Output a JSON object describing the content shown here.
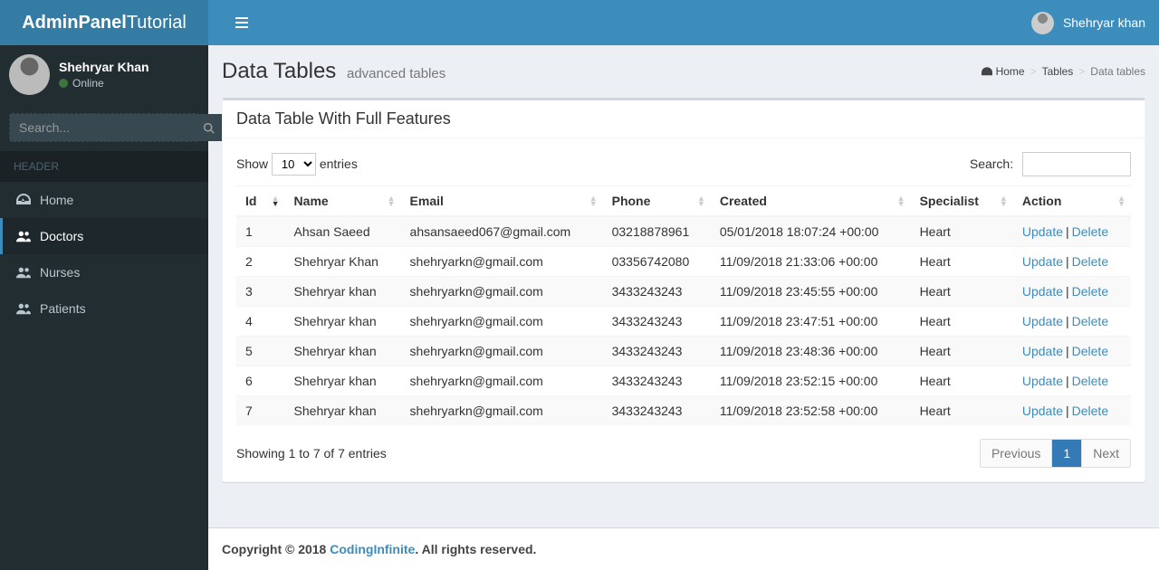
{
  "brand": {
    "bold": "AdminPanel",
    "light": "Tutorial"
  },
  "header_user": {
    "name": "Shehryar khan"
  },
  "sidebar": {
    "user": {
      "name": "Shehryar Khan",
      "status": "Online"
    },
    "search_placeholder": "Search...",
    "header": "HEADER",
    "items": [
      {
        "label": "Home",
        "icon": "dashboard",
        "active": false
      },
      {
        "label": "Doctors",
        "icon": "users",
        "active": true
      },
      {
        "label": "Nurses",
        "icon": "users",
        "active": false
      },
      {
        "label": "Patients",
        "icon": "users",
        "active": false
      }
    ]
  },
  "page": {
    "title": "Data Tables",
    "subtitle": "advanced tables",
    "breadcrumb": [
      {
        "label": "Home",
        "icon": true,
        "active": false
      },
      {
        "label": "Tables",
        "icon": false,
        "active": false
      },
      {
        "label": "Data tables",
        "icon": false,
        "active": true
      }
    ]
  },
  "box": {
    "title": "Data Table With Full Features",
    "length": {
      "prefix": "Show",
      "suffix": "entries",
      "value": "10"
    },
    "search_label": "Search:",
    "columns": [
      "Id",
      "Name",
      "Email",
      "Phone",
      "Created",
      "Specialist",
      "Action"
    ],
    "rows": [
      {
        "id": "1",
        "name": "Ahsan Saeed",
        "email": "ahsansaeed067@gmail.com",
        "phone": "03218878961",
        "created": "05/01/2018 18:07:24 +00:00",
        "specialist": "Heart"
      },
      {
        "id": "2",
        "name": "Shehryar Khan",
        "email": "shehryarkn@gmail.com",
        "phone": "03356742080",
        "created": "11/09/2018 21:33:06 +00:00",
        "specialist": "Heart"
      },
      {
        "id": "3",
        "name": "Shehryar khan",
        "email": "shehryarkn@gmail.com",
        "phone": "3433243243",
        "created": "11/09/2018 23:45:55 +00:00",
        "specialist": "Heart"
      },
      {
        "id": "4",
        "name": "Shehryar khan",
        "email": "shehryarkn@gmail.com",
        "phone": "3433243243",
        "created": "11/09/2018 23:47:51 +00:00",
        "specialist": "Heart"
      },
      {
        "id": "5",
        "name": "Shehryar khan",
        "email": "shehryarkn@gmail.com",
        "phone": "3433243243",
        "created": "11/09/2018 23:48:36 +00:00",
        "specialist": "Heart"
      },
      {
        "id": "6",
        "name": "Shehryar khan",
        "email": "shehryarkn@gmail.com",
        "phone": "3433243243",
        "created": "11/09/2018 23:52:15 +00:00",
        "specialist": "Heart"
      },
      {
        "id": "7",
        "name": "Shehryar khan",
        "email": "shehryarkn@gmail.com",
        "phone": "3433243243",
        "created": "11/09/2018 23:52:58 +00:00",
        "specialist": "Heart"
      }
    ],
    "actions": {
      "update": "Update",
      "delete": "Delete"
    },
    "info": "Showing 1 to 7 of 7 entries",
    "pagination": {
      "prev": "Previous",
      "next": "Next",
      "pages": [
        "1"
      ],
      "active": "1"
    }
  },
  "footer": {
    "prefix": "Copyright © 2018 ",
    "link": "CodingInfinite",
    "suffix": ". All rights reserved."
  }
}
